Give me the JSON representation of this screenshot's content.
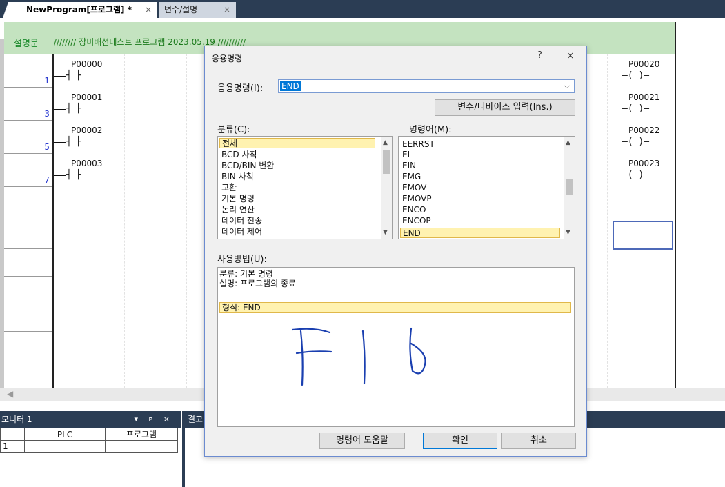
{
  "tabs": [
    {
      "label": "NewProgram[프로그램] *",
      "close": "×"
    },
    {
      "label": "변수/설명",
      "close": "×"
    }
  ],
  "editor": {
    "comment_label": "설명문",
    "comment_text": "//////// 장비배선테스트 프로그램 2023.05.19 //////////",
    "rungs": [
      {
        "number": "1",
        "contact": "P00000",
        "coil": "P00020"
      },
      {
        "number": "3",
        "contact": "P00001",
        "coil": "P00021"
      },
      {
        "number": "5",
        "contact": "P00002",
        "coil": "P00022"
      },
      {
        "number": "7",
        "contact": "P00003",
        "coil": "P00023"
      }
    ],
    "contact_symbol": "┤ ├",
    "coil_symbol": "–( )–",
    "scroll_left": "◀"
  },
  "monitor": {
    "title": "모니터 1",
    "tools": "▾ ᴘ ×",
    "columns": [
      "",
      "PLC",
      "프로그램"
    ],
    "rows": [
      [
        "1",
        "",
        ""
      ]
    ]
  },
  "result": {
    "title": "결고"
  },
  "dialog": {
    "title": "응용명령",
    "help": "?",
    "close": "×",
    "command_label": "응용명령(I):",
    "command_value": "END",
    "combo_arrow": "⌵",
    "var_button": "변수/디바이스 입력(Ins.)",
    "category_label": "분류(C):",
    "categories": [
      "전체",
      "BCD 사칙",
      "BCD/BIN 변환",
      "BIN 사칙",
      "교환",
      "기본 명령",
      "논리 연산",
      "데이터 전송",
      "데이터 제어"
    ],
    "keyword_label": "명령어(M):",
    "keywords": [
      "EERRST",
      "EI",
      "EIN",
      "EMG",
      "EMOV",
      "EMOVP",
      "ENCO",
      "ENCOP",
      "END"
    ],
    "usage_label": "사용방법(U):",
    "usage_lines": [
      "분류: 기본 명령",
      "설명: 프로그램의 종료"
    ],
    "usage_format": "형식: END",
    "help_button": "명령어 도움말",
    "ok_button": "확인",
    "cancel_button": "취소",
    "annotation_color": "#1a3fb0"
  }
}
